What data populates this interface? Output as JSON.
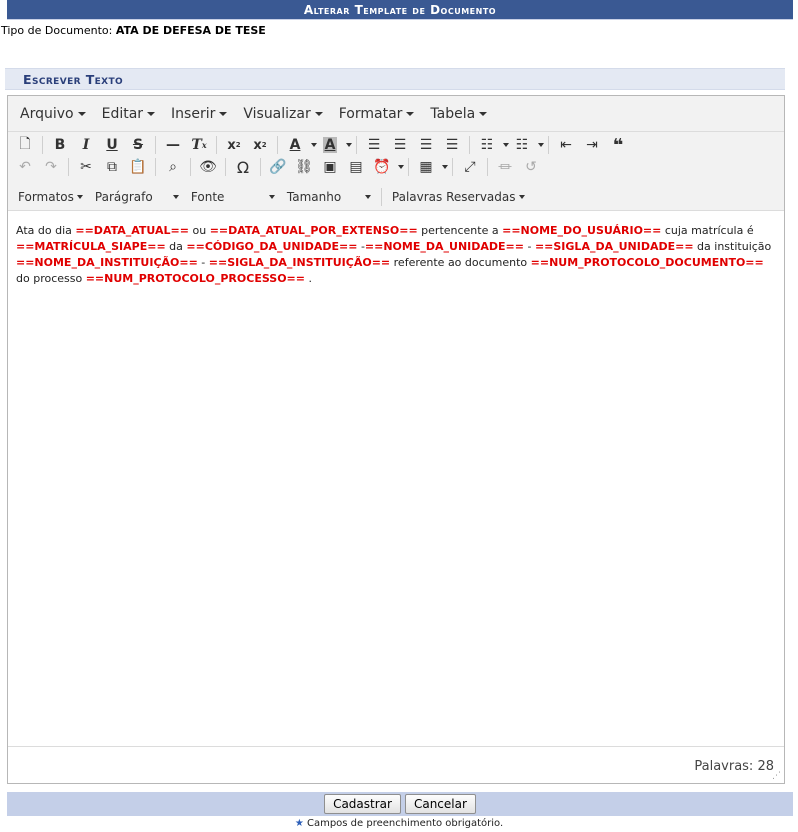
{
  "header": {
    "title": "Alterar Template de Documento"
  },
  "doctype": {
    "label": "Tipo de Documento:",
    "value": "ATA DE DEFESA DE TESE"
  },
  "section": {
    "title": "Escrever Texto"
  },
  "menubar": {
    "items": [
      "Arquivo",
      "Editar",
      "Inserir",
      "Visualizar",
      "Formatar",
      "Tabela"
    ]
  },
  "toolbar": {
    "row1_icons": [
      "new-document-icon",
      "bold-icon",
      "italic-icon",
      "underline-icon",
      "strikethrough-icon",
      "horizontal-line-icon",
      "clear-format-icon",
      "subscript-icon",
      "superscript-icon",
      "text-color-icon",
      "background-color-icon",
      "align-left-icon",
      "align-center-icon",
      "align-right-icon",
      "justify-icon",
      "bullet-list-icon",
      "numbered-list-icon",
      "outdent-icon",
      "indent-icon",
      "blockquote-icon"
    ],
    "row2_icons": [
      "undo-icon",
      "redo-icon",
      "cut-icon",
      "copy-icon",
      "paste-icon",
      "find-replace-icon",
      "preview-icon",
      "special-char-icon",
      "link-icon",
      "unlink-icon",
      "image-icon",
      "media-icon",
      "datetime-icon",
      "table-icon",
      "fullscreen-icon",
      "page-break-icon",
      "restore-draft-icon"
    ],
    "format_dropdowns": [
      "Formatos",
      "Parágrafo",
      "Fonte",
      "Tamanho",
      "Palavras Reservadas"
    ]
  },
  "content": {
    "p1": "Ata do dia ",
    "v1": "==DATA_ATUAL==",
    "p2": " ou ",
    "v2": "==DATA_ATUAL_POR_EXTENSO==",
    "p3": " pertencente a ",
    "v3": "==NOME_DO_USUÁRIO==",
    "p4": " cuja matrícula é ",
    "v4": "==MATRÍCULA_SIAPE==",
    "p5": " da ",
    "v5": "==CÓDIGO_DA_UNIDADE==",
    "p6": " -",
    "v6": "==NOME_DA_UNIDADE==",
    "p7": " - ",
    "v7": "==SIGLA_DA_UNIDADE==",
    "p8": " da instituição ",
    "v8": "==NOME_DA_INSTITUIÇÃO==",
    "p9": " - ",
    "v9": "==SIGLA_DA_INSTITUIÇÃO==",
    "p10": " referente ao documento ",
    "v10": "==NUM_PROTOCOLO_DOCUMENTO==",
    "p11": " do processo ",
    "v11": "==NUM_PROTOCOLO_PROCESSO==",
    "p12": " ."
  },
  "status": {
    "words": "Palavras: 28"
  },
  "buttons": {
    "submit": "Cadastrar",
    "cancel": "Cancelar"
  },
  "footer": {
    "required_note": "Campos de preenchimento obrigatório."
  },
  "colors": {
    "title_bg": "#3a5993",
    "variable": "#e00000",
    "footer_bg": "#c4cfe8"
  }
}
